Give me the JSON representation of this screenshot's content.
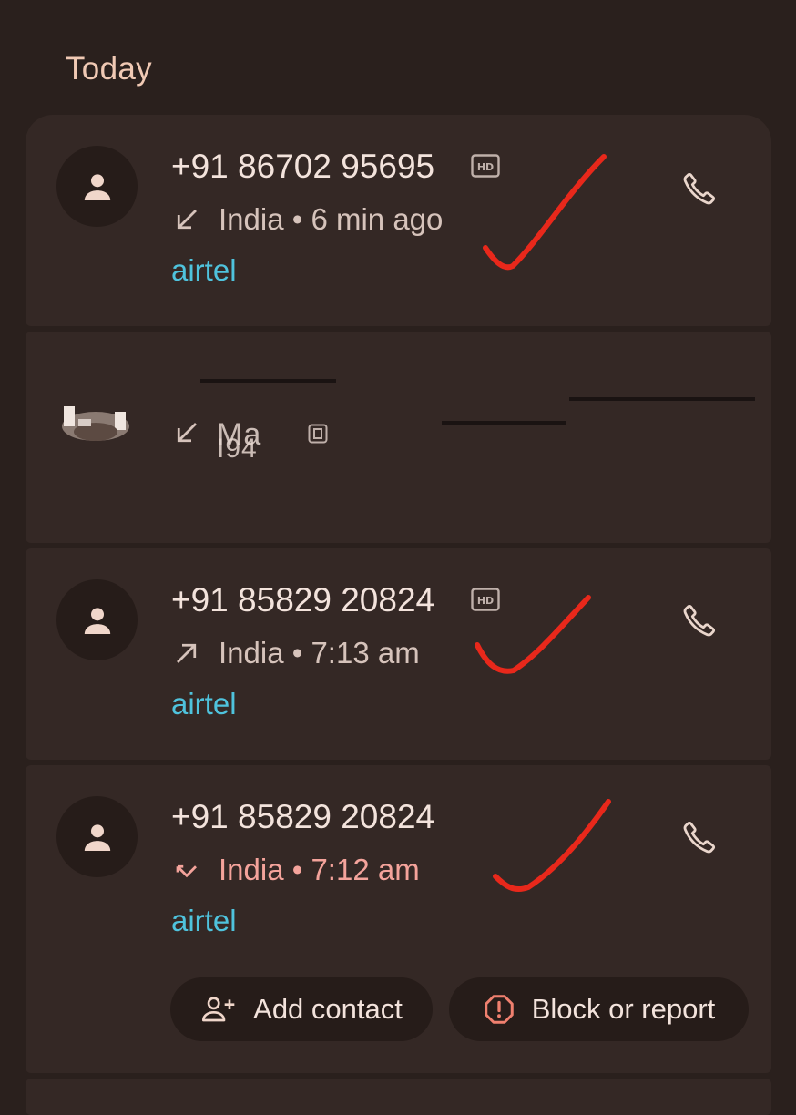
{
  "section": {
    "title": "Today"
  },
  "calls": [
    {
      "number": "+91 86702 95695",
      "direction": "incoming",
      "location": "India",
      "time": "6 min ago",
      "carrier": "airtel"
    },
    {
      "name": "Ma",
      "direction": "incoming",
      "detail": "I94"
    },
    {
      "number": "+91 85829 20824",
      "direction": "outgoing",
      "location": "India",
      "time": "7:13 am",
      "carrier": "airtel"
    },
    {
      "number": "+91 85829 20824",
      "direction": "missed",
      "location": "India",
      "time": "7:12 am",
      "carrier": "airtel"
    }
  ],
  "actions": {
    "add_contact": "Add contact",
    "block_report": "Block or report"
  },
  "separator": " • ",
  "colors": {
    "background": "#2a201d",
    "card": "#342825",
    "carrier": "#4fc3dd",
    "missed": "#f4a39b",
    "checkmark": "#e8281b",
    "title": "#f0c9b4"
  }
}
